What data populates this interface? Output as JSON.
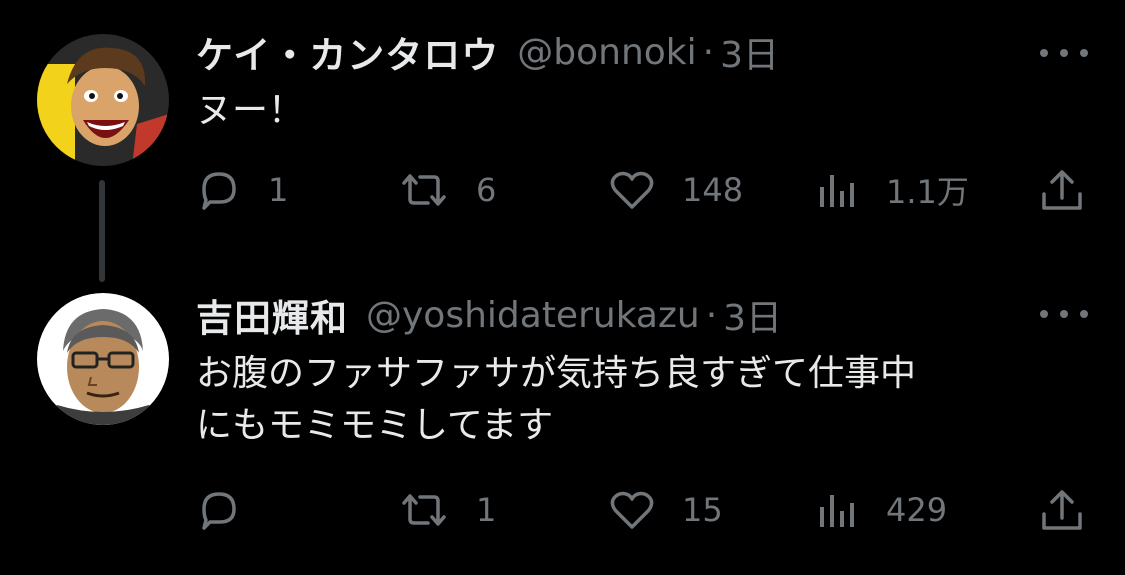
{
  "tweets": [
    {
      "author_name": "ケイ・カンタロウ",
      "handle": "@bonnoki",
      "separator": "·",
      "time": "3日",
      "text": "ヌー！",
      "replies": "1",
      "retweets": "6",
      "likes": "148",
      "views": "1.1万",
      "avatar_icon": "manga-man-avatar-icon"
    },
    {
      "author_name": "吉田輝和",
      "handle": "@yoshidaterukazu",
      "separator": "·",
      "time": "3日",
      "text": "お腹のファサファサが気持ち良すぎて仕事中\nにもモミモミしてます",
      "replies": "",
      "retweets": "1",
      "likes": "15",
      "views": "429",
      "avatar_icon": "glasses-man-avatar-icon"
    }
  ],
  "colors": {
    "background": "#000000",
    "primary_text": "#e7e9ea",
    "secondary_text": "#71767b",
    "thread_line": "#333639"
  },
  "icons": {
    "reply": "reply-icon",
    "retweet": "retweet-icon",
    "like": "heart-icon",
    "views": "views-icon",
    "share": "share-icon",
    "more": "more-icon"
  }
}
